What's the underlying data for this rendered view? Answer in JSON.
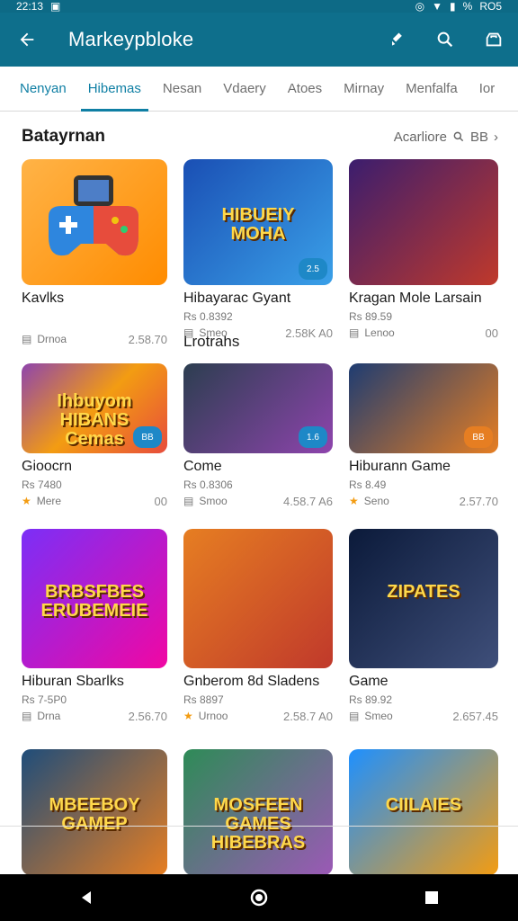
{
  "status": {
    "time": "22:13",
    "battery": "%",
    "right_text": "RO5"
  },
  "appbar": {
    "title": "Markeypbloke"
  },
  "tabs": [
    "Nenyan",
    "Hibemas",
    "Nesan",
    "Vdaery",
    "Atoes",
    "Mirnay",
    "Menfalfa",
    "Ior"
  ],
  "section": {
    "title": "Batayrnan",
    "more": "Acarliore",
    "more_icon": "search-icon",
    "more_text": "BB"
  },
  "subtitle": "Lrotrahs",
  "cards": [
    {
      "name": "Kavlks",
      "price": "",
      "meta_label": "Drnoa",
      "meta_right": "2.58.70",
      "badge": "",
      "tile_text": "",
      "theme": "gamepad"
    },
    {
      "name": "Hibayarac Gyant",
      "price": "Rs 0.8392",
      "meta_label": "Smeo",
      "meta_right": "2.58K A0",
      "badge": "2.5",
      "tile_text": "HIBUEIY\nMOHA",
      "theme": "blue"
    },
    {
      "name": "Kragan Mole Larsain",
      "price": "Rs 89.59",
      "meta_label": "Lenoo",
      "meta_right": "00",
      "badge": "",
      "tile_text": "",
      "theme": "purple"
    },
    {
      "name": "Gioocrn",
      "price": "Rs 7480",
      "meta_label": "Mere",
      "meta_right": "00",
      "badge": "BB",
      "tile_text": "Ihbuyom\nHIBANS\nCemas",
      "theme": "rainbow"
    },
    {
      "name": "Come",
      "price": "Rs 0.8306",
      "meta_label": "Smoo",
      "meta_right": "4.58.7 A6",
      "badge": "1.6",
      "tile_text": "",
      "theme": "ball"
    },
    {
      "name": "Hiburann Game",
      "price": "Rs 8.49",
      "meta_label": "Seno",
      "meta_right": "2.57.70",
      "badge": "BB",
      "tile_text": "",
      "theme": "hero"
    },
    {
      "name": "Hiburan Sbarlks",
      "price": "Rs 7-5P0",
      "meta_label": "Drna",
      "meta_right": "2.56.70",
      "badge": "",
      "tile_text": "BRBSFBES\nERUBEMEIE",
      "theme": "dog"
    },
    {
      "name": "Gnberom 8d Sladens",
      "price": "Rs 8897",
      "meta_label": "Urnoo",
      "meta_right": "2.58.7 A0",
      "badge": "",
      "tile_text": "",
      "theme": "girl"
    },
    {
      "name": "Game",
      "price": "Rs 89.92",
      "meta_label": "Smeo",
      "meta_right": "2.657.45",
      "badge": "",
      "tile_text": "ZIPATES",
      "theme": "warrior"
    },
    {
      "name": "",
      "price": "",
      "meta_label": "",
      "meta_right": "",
      "badge": "",
      "tile_text": "MBEEBOY\nGAMEP",
      "theme": "guitar"
    },
    {
      "name": "",
      "price": "",
      "meta_label": "",
      "meta_right": "",
      "badge": "",
      "tile_text": "MOSFEEN\nGAMES\nHIBEBRAS",
      "theme": "garden"
    },
    {
      "name": "",
      "price": "",
      "meta_label": "",
      "meta_right": "",
      "badge": "",
      "tile_text": "CIILAIES",
      "theme": "soldiers"
    }
  ],
  "colors": {
    "accent": "#0f7fa4",
    "appbar": "#0e6f8c"
  }
}
